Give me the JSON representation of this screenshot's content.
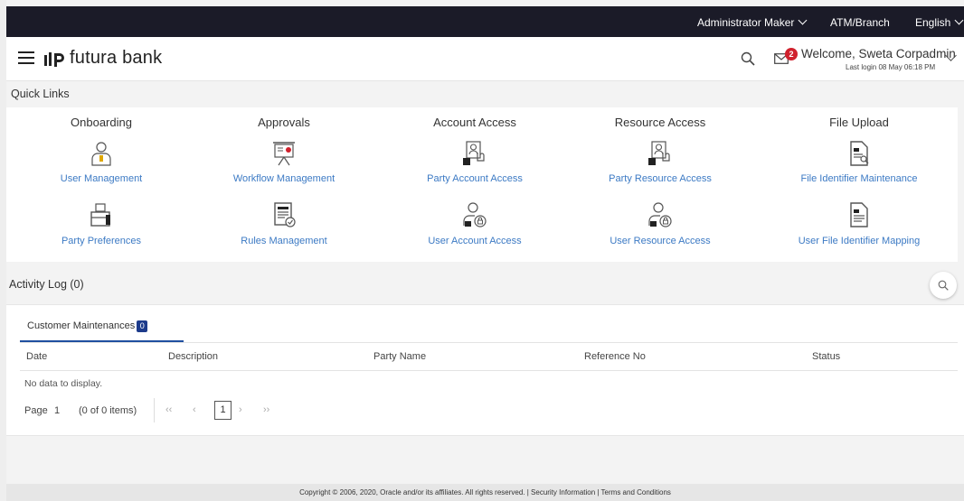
{
  "topbar": {
    "role": "Administrator Maker",
    "branch": "ATM/Branch",
    "language": "English"
  },
  "header": {
    "brand": "futura bank",
    "notification_count": "2",
    "welcome": "Welcome, Sweta Corpadmin",
    "last_login": "Last login 08 May 06:18 PM"
  },
  "quick_links": {
    "title": "Quick Links",
    "columns": [
      {
        "category": "Onboarding",
        "links": [
          "User Management",
          "Party Preferences"
        ]
      },
      {
        "category": "Approvals",
        "links": [
          "Workflow Management",
          "Rules Management"
        ]
      },
      {
        "category": "Account Access",
        "links": [
          "Party Account Access",
          "User Account Access"
        ]
      },
      {
        "category": "Resource Access",
        "links": [
          "Party Resource Access",
          "User Resource Access"
        ]
      },
      {
        "category": "File Upload",
        "links": [
          "File Identifier Maintenance",
          "User File Identifier Mapping"
        ]
      }
    ]
  },
  "activity_log": {
    "title": "Activity Log (0)",
    "tab_label": "Customer Maintenances",
    "tab_count": "0",
    "columns": [
      "Date",
      "Description",
      "Party Name",
      "Reference No",
      "Status"
    ],
    "empty_text": "No data to display.",
    "pager": {
      "page_label": "Page",
      "page_value": "1",
      "items_text": "(0 of 0 items)",
      "current_page": "1"
    }
  },
  "footer": {
    "text": "Copyright © 2006, 2020, Oracle and/or its affiliates. All rights reserved. | Security Information | Terms and Conditions"
  },
  "colors": {
    "topbar": "#1b1b28",
    "link": "#3c7ac4",
    "badge": "#d0212d",
    "tab_badge": "#1d3b8b"
  }
}
